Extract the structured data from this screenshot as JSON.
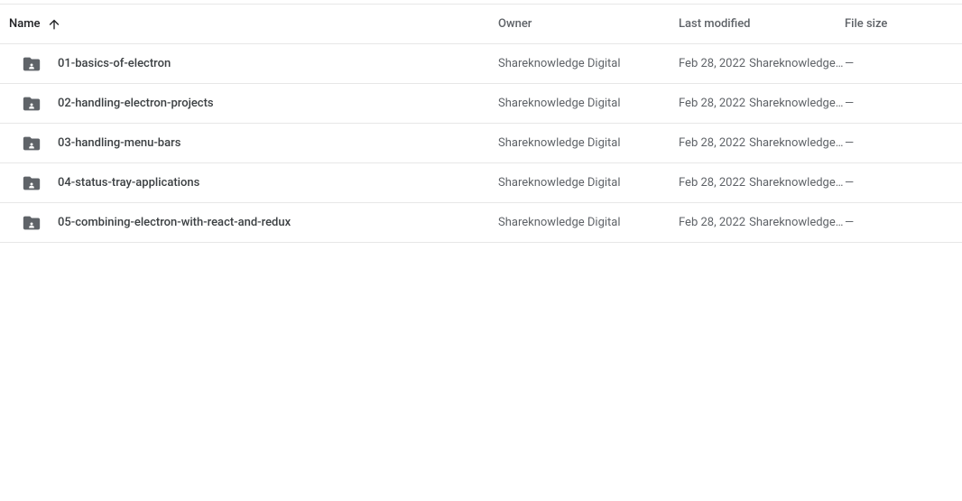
{
  "columns": {
    "name": "Name",
    "owner": "Owner",
    "last_modified": "Last modified",
    "file_size": "File size"
  },
  "rows": [
    {
      "name": "01-basics-of-electron",
      "owner": "Shareknowledge Digital",
      "modified_date": "Feb 28, 2022",
      "modified_by": "Shareknowledge …",
      "size": "—"
    },
    {
      "name": "02-handling-electron-projects",
      "owner": "Shareknowledge Digital",
      "modified_date": "Feb 28, 2022",
      "modified_by": "Shareknowledge …",
      "size": "—"
    },
    {
      "name": "03-handling-menu-bars",
      "owner": "Shareknowledge Digital",
      "modified_date": "Feb 28, 2022",
      "modified_by": "Shareknowledge …",
      "size": "—"
    },
    {
      "name": "04-status-tray-applications",
      "owner": "Shareknowledge Digital",
      "modified_date": "Feb 28, 2022",
      "modified_by": "Shareknowledge …",
      "size": "—"
    },
    {
      "name": "05-combining-electron-with-react-and-redux",
      "owner": "Shareknowledge Digital",
      "modified_date": "Feb 28, 2022",
      "modified_by": "Shareknowledge …",
      "size": "—"
    }
  ]
}
